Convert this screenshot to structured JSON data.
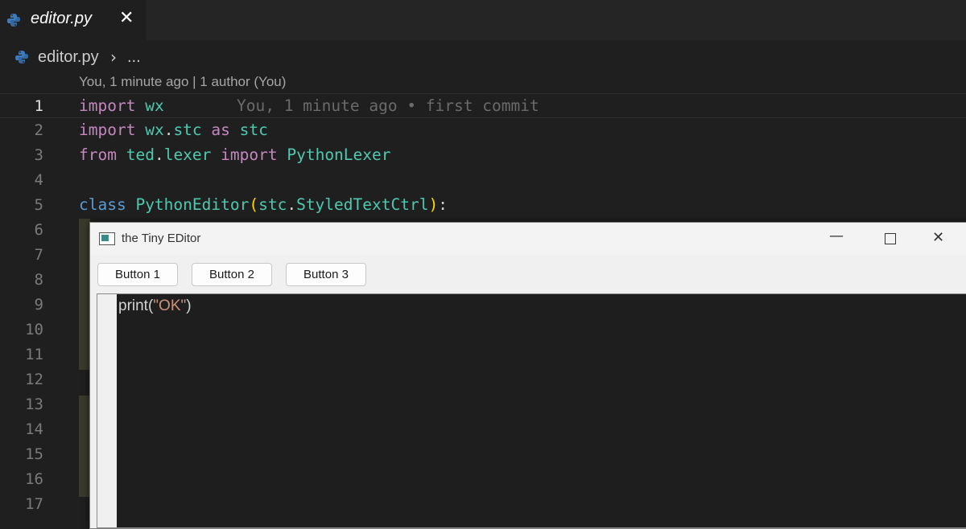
{
  "tab": {
    "title": "editor.py",
    "close_glyph": "✕",
    "icon": "python-icon"
  },
  "breadcrumb": {
    "file": "editor.py",
    "separator": "›",
    "more": "...",
    "icon": "python-icon"
  },
  "codelens": "You, 1 minute ago | 1 author (You)",
  "blame": "You, 1 minute ago • first commit",
  "line_numbers": [
    "1",
    "2",
    "3",
    "4",
    "5",
    "6",
    "7",
    "8",
    "9",
    "10",
    "11",
    "12",
    "13",
    "14",
    "15",
    "16",
    "17"
  ],
  "code": {
    "l1": {
      "kw": "import",
      "mod": "wx"
    },
    "l2": {
      "kw": "import",
      "mod1": "wx",
      "dot": ".",
      "mod2": "stc",
      "kw2": "as",
      "alias": "stc"
    },
    "l3": {
      "kw": "from",
      "mod1": "ted",
      "dot": ".",
      "mod2": "lexer",
      "kw2": "import",
      "cls": "PythonLexer"
    },
    "l5": {
      "kw": "class",
      "cls": "PythonEditor",
      "open": "(",
      "base1": "stc",
      "dot": ".",
      "base2": "StyledTextCtrl",
      "close": ")",
      "colon": ":"
    }
  },
  "wx_window": {
    "title": "the Tiny EDitor",
    "min_glyph": "—",
    "close_glyph": "✕",
    "buttons": [
      "Button 1",
      "Button 2",
      "Button 3"
    ],
    "editor_text": {
      "func": "print(",
      "string": "\"OK\"",
      "end": ")"
    }
  },
  "colors": {
    "keyword": "#c586c0",
    "class": "#4ec9b0",
    "string": "#ce9178",
    "background": "#1f1f1f"
  }
}
